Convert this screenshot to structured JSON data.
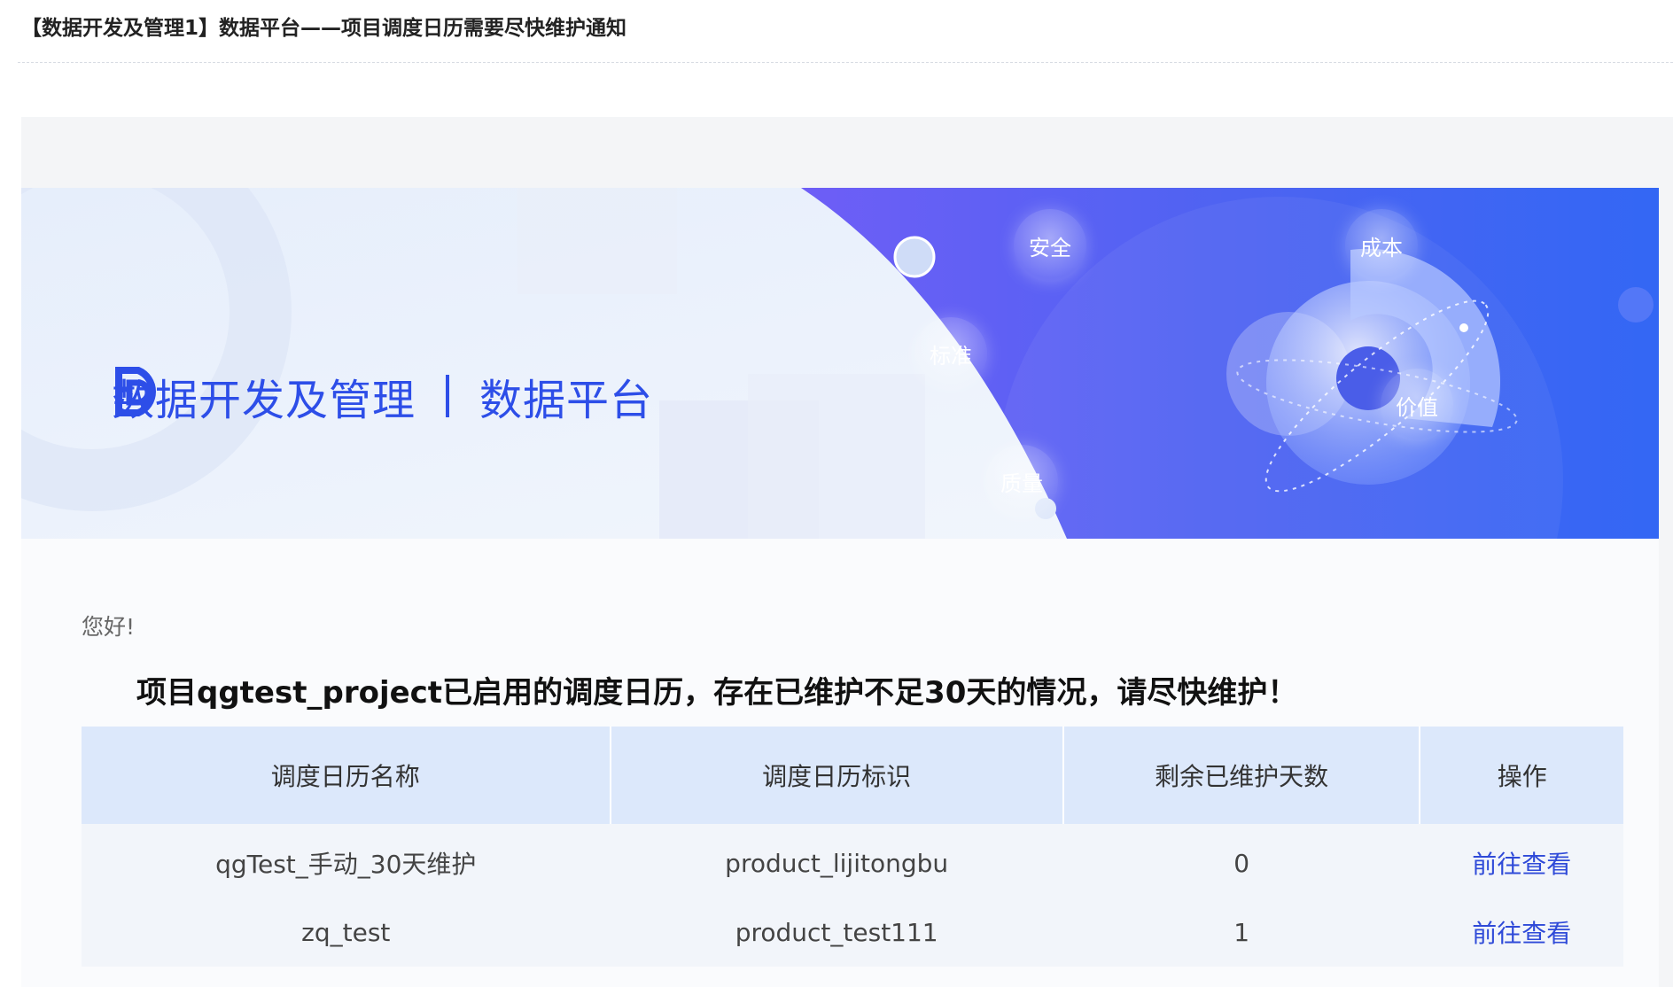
{
  "mail": {
    "subject": "【数据开发及管理1】数据平台——项目调度日历需要尽快维护通知"
  },
  "banner": {
    "brand_title": "数据开发及管理",
    "brand_subtitle": "数据平台",
    "tags": [
      "安全",
      "成本",
      "标准",
      "价值",
      "质量"
    ],
    "colors": {
      "brand": "#2d4ee8",
      "panel_start": "#6a5cf6",
      "panel_end": "#3a63f3"
    }
  },
  "content": {
    "greeting": "您好!",
    "notice": "项目qgtest_project已启用的调度日历，存在已维护不足30天的情况，请尽快维护！",
    "table": {
      "headers": [
        "调度日历名称",
        "调度日历标识",
        "剩余已维护天数",
        "操作"
      ],
      "rows": [
        {
          "name": "qgTest_手动_30天维护",
          "id": "product_lijitongbu",
          "days": "0",
          "action": "前往查看"
        },
        {
          "name": "zq_test",
          "id": "product_test111",
          "days": "1",
          "action": "前往查看"
        }
      ]
    }
  }
}
